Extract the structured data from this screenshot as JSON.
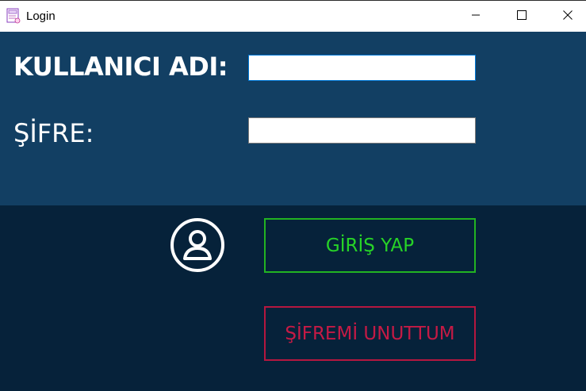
{
  "window": {
    "title": "Login",
    "app_icon": "login-app-icon",
    "controls": [
      "minimize-icon",
      "maximize-icon",
      "close-icon"
    ]
  },
  "form": {
    "username_label": "KULLANICI ADI:",
    "password_label": "ŞİFRE:",
    "username_value": "",
    "password_value": ""
  },
  "actions": {
    "avatar_icon": "user-avatar-icon",
    "login_label": "GİRİŞ YAP",
    "forgot_label": "ŞİFREMİ UNUTTUM"
  },
  "colors": {
    "top_panel": "#123f63",
    "bottom_panel": "#06223a",
    "login_accent": "#27d327",
    "forgot_accent": "#c51a45"
  }
}
